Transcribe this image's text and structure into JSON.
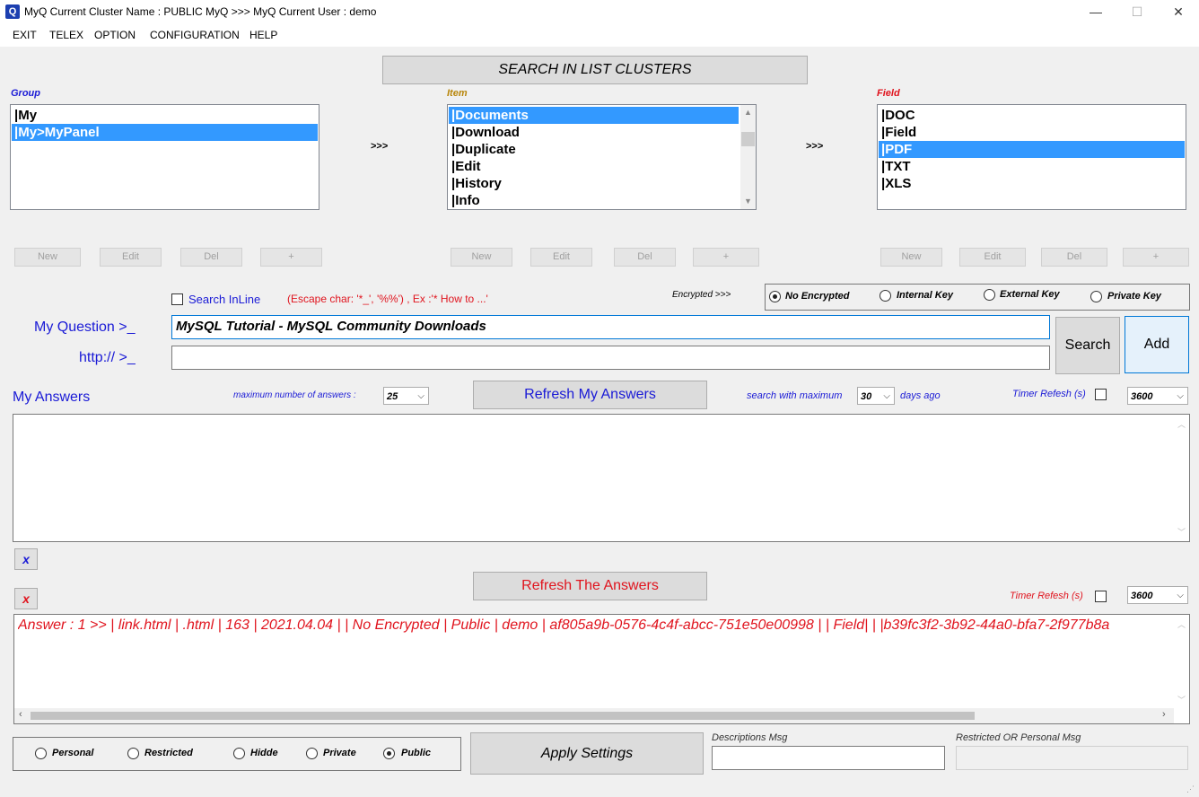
{
  "window": {
    "icon_letter": "Q",
    "title": "MyQ Current Cluster Name : PUBLIC MyQ >>> MyQ Current User : demo",
    "minimize": "—",
    "maximize": "☐",
    "close": "✕"
  },
  "menu": [
    "EXIT",
    "TELEX",
    "OPTION",
    "CONFIGURATION",
    "HELP"
  ],
  "search_clusters_label": "SEARCH IN LIST CLUSTERS",
  "group": {
    "label": "Group",
    "items": [
      "|My",
      "|My>MyPanel"
    ],
    "selected": 1,
    "buttons": [
      "New",
      "Edit",
      "Del",
      "+"
    ]
  },
  "arrows": ">>>",
  "item": {
    "label": "Item",
    "items": [
      "|Documents",
      "|Download",
      "|Duplicate",
      "|Edit",
      "|History",
      "|Info"
    ],
    "selected": 0,
    "buttons": [
      "New",
      "Edit",
      "Del",
      "+"
    ]
  },
  "field": {
    "label": "Field",
    "items": [
      "|DOC",
      "|Field",
      "|PDF",
      "|TXT",
      "|XLS"
    ],
    "selected": 2,
    "buttons": [
      "New",
      "Edit",
      "Del",
      "+"
    ]
  },
  "search_inline": {
    "label": "Search InLine",
    "checked": false,
    "escape_hint": "(Escape char: '*_', '%%') , Ex :'* How to ...'"
  },
  "encryption": {
    "label": "Encrypted >>>",
    "options": [
      "No Encrypted",
      "Internal Key",
      "External Key",
      "Private Key"
    ],
    "selected": "No Encrypted"
  },
  "question": {
    "label": "My Question >_",
    "value": "MySQL Tutorial - MySQL Community Downloads"
  },
  "url": {
    "label": "http:// >_",
    "value": ""
  },
  "search_button": "Search",
  "add_button": "Add",
  "my_answers": {
    "label": "My Answers",
    "max_label": "maximum number of answers :",
    "max_value": "25",
    "refresh_button": "Refresh My Answers",
    "search_max_label": "search with maximum",
    "days_value": "30",
    "days_label": "days ago",
    "timer_label": "Timer Refesh (s)",
    "timer_checked": false,
    "timer_value": "3600",
    "clear_button": "x"
  },
  "answers": {
    "clear_button": "x",
    "refresh_button": "Refresh The Answers",
    "timer_label": "Timer Refesh (s)",
    "timer_checked": false,
    "timer_value": "3600",
    "rows": [
      "Answer : 1 >> | link.html | .html | 163 | 2021.04.04 |  | No Encrypted | Public | demo | af805a9b-0576-4c4f-abcc-751e50e00998 |  | Field|   | |b39fc3f2-3b92-44a0-bfa7-2f977b8a"
    ]
  },
  "visibility": {
    "options": [
      "Personal",
      "Restricted",
      "Hidde",
      "Private",
      "Public"
    ],
    "selected": "Public"
  },
  "apply_button": "Apply Settings",
  "descriptions_label": "Descriptions Msg",
  "descriptions_value": "",
  "restricted_label": "Restricted OR Personal Msg",
  "restricted_value": "",
  "colors": {
    "selection": "#3399ff",
    "blue_text": "#1a1ad6",
    "red_text": "#e0141e",
    "item_label": "#b8860b"
  }
}
